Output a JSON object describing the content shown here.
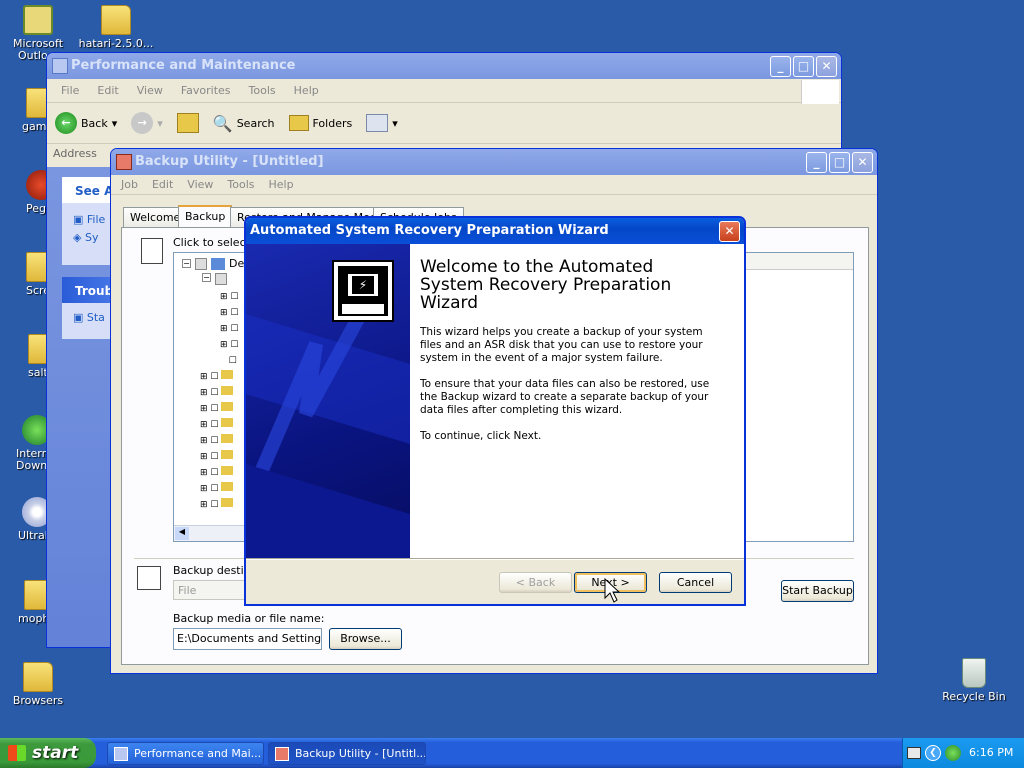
{
  "desktop": {
    "icons": [
      {
        "label": "Microsoft Outlo...",
        "name": "desktop-icon-outlook"
      },
      {
        "label": "hatari-2.5.0...",
        "name": "desktop-icon-hatari"
      },
      {
        "label": "game",
        "name": "desktop-icon-games"
      },
      {
        "label": "Peg",
        "name": "desktop-icon-peg"
      },
      {
        "label": "Scre",
        "name": "desktop-icon-screen"
      },
      {
        "label": "salt",
        "name": "desktop-icon-salt"
      },
      {
        "label": "Interr Downl",
        "name": "desktop-icon-internet-download"
      },
      {
        "label": "UltraI",
        "name": "desktop-icon-ultraiso"
      },
      {
        "label": "moph",
        "name": "desktop-icon-moph"
      },
      {
        "label": "Browsers",
        "name": "desktop-icon-browsers"
      },
      {
        "label": "Recycle Bin",
        "name": "desktop-icon-recycle-bin"
      }
    ]
  },
  "perf_window": {
    "title": "Performance and Maintenance",
    "menu": [
      "File",
      "Edit",
      "View",
      "Favorites",
      "Tools",
      "Help"
    ],
    "toolbar": {
      "back": "Back",
      "search": "Search",
      "folders": "Folders"
    },
    "address_label": "Address",
    "side_panel_1_title": "See Al",
    "side_panel_1_items": [
      "File",
      "Sy"
    ],
    "side_panel_2_title": "Troubl",
    "side_panel_2_items": [
      "Sta"
    ]
  },
  "backup_window": {
    "title": "Backup Utility - [Untitled]",
    "menu": [
      "Job",
      "Edit",
      "View",
      "Tools",
      "Help"
    ],
    "tabs": [
      "Welcome",
      "Backup",
      "Restore and Manage Media",
      "Schedule Jobs"
    ],
    "select_label": "Click to select",
    "tree_root_label": "De",
    "backup_destination_label": "Backup destina",
    "backup_destination_value": "File",
    "media_label": "Backup media or file name:",
    "media_value": "E:\\Documents and Settings\\V",
    "browse_button": "Browse...",
    "start_backup_button": "Start Backup"
  },
  "wizard": {
    "title": "Automated System Recovery Preparation Wizard",
    "heading": "Welcome to the Automated System Recovery Preparation Wizard",
    "para1": "This wizard helps you create a backup of your system files and an ASR disk that you can use to restore your system in the event of a major system failure.",
    "para2": "To ensure that your data files can also be restored, use the Backup wizard to create a separate backup of your data files after completing this wizard.",
    "para3": "To continue, click Next.",
    "back_button": "< Back",
    "next_button": "Next >",
    "cancel_button": "Cancel"
  },
  "taskbar": {
    "start_label": "start",
    "tasks": [
      "Performance and Mai...",
      "Backup Utility - [Untitl..."
    ],
    "clock": "6:16 PM"
  }
}
